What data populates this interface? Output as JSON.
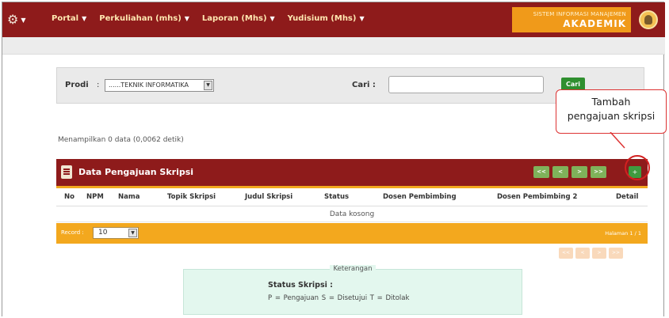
{
  "topbar": {
    "nav": [
      {
        "label": "Portal"
      },
      {
        "label": "Perkuliahan (mhs)"
      },
      {
        "label": "Laporan (Mhs)"
      },
      {
        "label": "Yudisium (Mhs)"
      }
    ],
    "brand_top": "SISTEM INFORMASI MANAJEMEN",
    "brand_bottom": "AKADEMIK",
    "colors": {
      "bar": "#8e1b1b",
      "brand": "#f09a1a"
    }
  },
  "filter": {
    "prodi_label": "Prodi",
    "prodi_sep": ":",
    "prodi_value": "......TEKNIK INFORMATIKA",
    "cari_label": "Cari :",
    "cari_value": "",
    "cari_button": "Cari"
  },
  "callout": {
    "line1": "Tambah",
    "line2": "pengajuan skripsi"
  },
  "result_info": "Menampilkan 0 data (0,0062 detik)",
  "panel": {
    "title": "Data Pengajuan Skripsi",
    "pager": [
      "<<",
      "<",
      ">",
      ">>"
    ],
    "add_button": "+"
  },
  "table": {
    "headers": [
      "No",
      "NPM",
      "Nama",
      "Topik Skripsi",
      "Judul Skripsi",
      "Status",
      "Dosen Pembimbing",
      "Dosen Pembimbing 2",
      "Detail"
    ],
    "rows": [],
    "empty_text": "Data kosong"
  },
  "footer": {
    "record_label": "Record :",
    "record_value": "10",
    "page_info": "Halaman 1 / 1",
    "pager": [
      "<<",
      "<",
      ">",
      ">>"
    ]
  },
  "legend": {
    "caption": "Keterangan",
    "status_label": "Status Skripsi :",
    "codes": "P = Pengajuan   S = Disetujui   T = Ditolak"
  }
}
